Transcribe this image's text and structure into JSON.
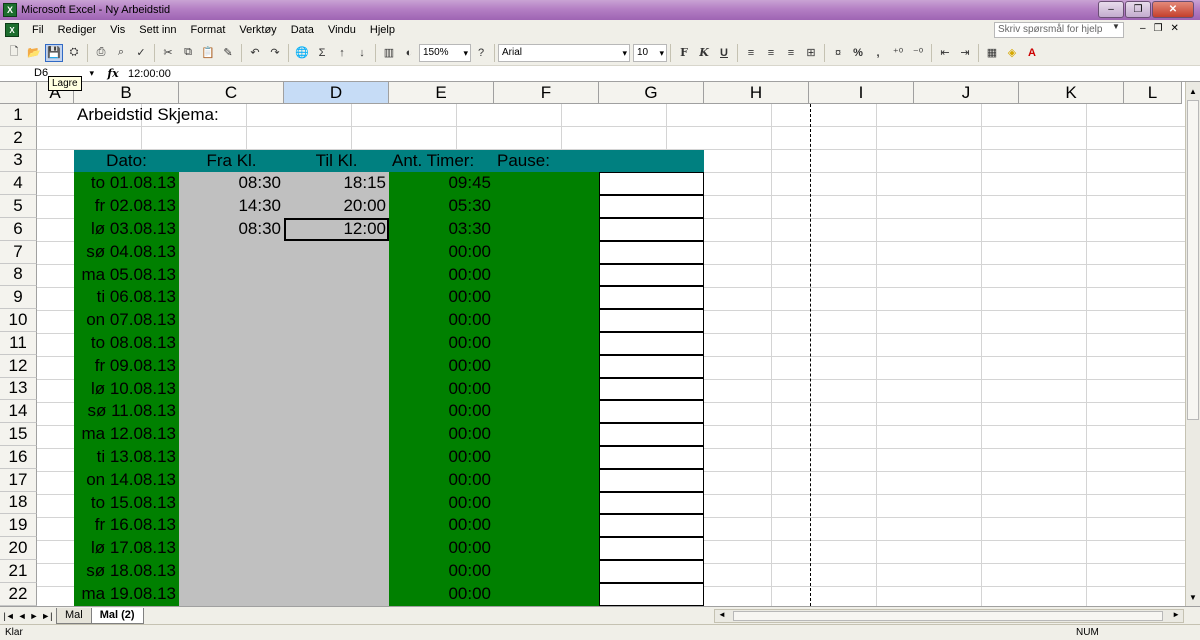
{
  "window": {
    "title": "Microsoft Excel - Ny Arbeidstid",
    "minimize_label": "–",
    "maximize_label": "❐",
    "close_label": "✕"
  },
  "menu": {
    "items": [
      "Fil",
      "Rediger",
      "Vis",
      "Sett inn",
      "Format",
      "Verktøy",
      "Data",
      "Vindu",
      "Hjelp"
    ],
    "help_placeholder": "Skriv spørsmål for hjelp",
    "doc_minimize": "–",
    "doc_restore": "❐",
    "doc_close": "✕"
  },
  "toolbar": {
    "zoom": "150%",
    "font_name": "Arial",
    "font_size": "10",
    "bold": "F",
    "italic": "K",
    "underline": "U",
    "percent": "%",
    "comma": ",",
    "tooltip": "Lagre"
  },
  "formula_bar": {
    "name_box": "D6",
    "fx_label": "fx",
    "value": "12:00:00"
  },
  "grid": {
    "columns": [
      "A",
      "B",
      "C",
      "D",
      "E",
      "F",
      "G",
      "H",
      "I",
      "J",
      "K",
      "L"
    ],
    "selected_column": "D",
    "rows": [
      "1",
      "2",
      "3",
      "4",
      "5",
      "6",
      "7",
      "8",
      "9",
      "10",
      "11",
      "12",
      "13",
      "14",
      "15",
      "16",
      "17",
      "18",
      "19",
      "20",
      "21",
      "22"
    ],
    "title": "Arbeidstid Skjema:",
    "headers": {
      "dato": "Dato:",
      "fra": "Fra Kl.",
      "til": "Til Kl.",
      "timer": "Ant. Timer:",
      "pause": "Pause:"
    },
    "data_rows": [
      {
        "dato": "to 01.08.13",
        "fra": "08:30",
        "til": "18:15",
        "timer": "09:45"
      },
      {
        "dato": "fr 02.08.13",
        "fra": "14:30",
        "til": "20:00",
        "timer": "05:30"
      },
      {
        "dato": "lø 03.08.13",
        "fra": "08:30",
        "til": "12:00",
        "timer": "03:30"
      },
      {
        "dato": "sø 04.08.13",
        "fra": "",
        "til": "",
        "timer": "00:00"
      },
      {
        "dato": "ma 05.08.13",
        "fra": "",
        "til": "",
        "timer": "00:00"
      },
      {
        "dato": "ti 06.08.13",
        "fra": "",
        "til": "",
        "timer": "00:00"
      },
      {
        "dato": "on 07.08.13",
        "fra": "",
        "til": "",
        "timer": "00:00"
      },
      {
        "dato": "to 08.08.13",
        "fra": "",
        "til": "",
        "timer": "00:00"
      },
      {
        "dato": "fr 09.08.13",
        "fra": "",
        "til": "",
        "timer": "00:00"
      },
      {
        "dato": "lø 10.08.13",
        "fra": "",
        "til": "",
        "timer": "00:00"
      },
      {
        "dato": "sø 11.08.13",
        "fra": "",
        "til": "",
        "timer": "00:00"
      },
      {
        "dato": "ma 12.08.13",
        "fra": "",
        "til": "",
        "timer": "00:00"
      },
      {
        "dato": "ti 13.08.13",
        "fra": "",
        "til": "",
        "timer": "00:00"
      },
      {
        "dato": "on 14.08.13",
        "fra": "",
        "til": "",
        "timer": "00:00"
      },
      {
        "dato": "to 15.08.13",
        "fra": "",
        "til": "",
        "timer": "00:00"
      },
      {
        "dato": "fr 16.08.13",
        "fra": "",
        "til": "",
        "timer": "00:00"
      },
      {
        "dato": "lø 17.08.13",
        "fra": "",
        "til": "",
        "timer": "00:00"
      },
      {
        "dato": "sø 18.08.13",
        "fra": "",
        "til": "",
        "timer": "00:00"
      },
      {
        "dato": "ma 19.08.13",
        "fra": "",
        "til": "",
        "timer": "00:00"
      }
    ]
  },
  "sheets": {
    "tabs": [
      "Mal",
      "Mal (2)"
    ],
    "active": "Mal (2)"
  },
  "status": {
    "left": "Klar",
    "num": "NUM"
  },
  "colors": {
    "header_teal": "#008080",
    "date_green": "#008000",
    "input_gray": "#c0c0c0"
  }
}
